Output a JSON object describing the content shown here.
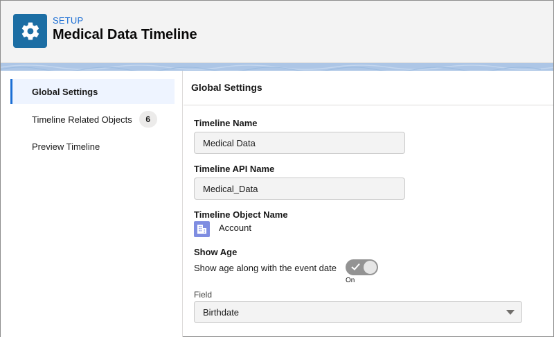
{
  "header": {
    "setup_label": "SETUP",
    "title": "Medical Data Timeline",
    "icon": "gear-icon"
  },
  "sidebar": {
    "items": [
      {
        "label": "Global Settings",
        "active": true
      },
      {
        "label": "Timeline Related Objects",
        "badge": "6"
      },
      {
        "label": "Preview Timeline"
      }
    ]
  },
  "main": {
    "section_title": "Global Settings",
    "timeline_name": {
      "label": "Timeline Name",
      "value": "Medical Data"
    },
    "api_name": {
      "label": "Timeline API Name",
      "value": "Medical_Data"
    },
    "object": {
      "label": "Timeline Object Name",
      "value": "Account",
      "icon": "account-building-icon"
    },
    "show_age": {
      "label": "Show Age",
      "help_text": "Show age along with the event date",
      "state_text": "On",
      "enabled": true
    },
    "field": {
      "label": "Field",
      "value": "Birthdate"
    }
  },
  "colors": {
    "brand_blue": "#1b6ed4",
    "setup_icon_bg": "#1c6ea4",
    "object_icon_bg": "#7f8de1",
    "band": "#adc6e6"
  }
}
